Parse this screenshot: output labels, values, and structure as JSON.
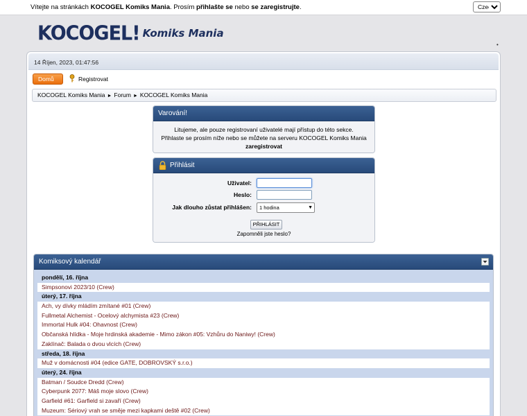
{
  "topbar": {
    "welcome_prefix": "Vítejte na stránkách ",
    "site_name": "KOCOGEL Komiks Mania",
    "welcome_mid": ". Prosím ",
    "login_link": "přihlašte se",
    "welcome_or": " nebo ",
    "register_link": "se zaregistrujte",
    "welcome_end": ".",
    "language": "Czech"
  },
  "logo": {
    "main": "KOCOGEL!",
    "sub": "Komiks Mania"
  },
  "header": {
    "datetime": "14 Říjen, 2023, 01:47:56"
  },
  "menu": {
    "home": "Domů",
    "register": "Registrovat"
  },
  "breadcrumb": [
    "KOCOGEL Komiks Mania",
    "Forum",
    "KOCOGEL Komiks Mania"
  ],
  "warning": {
    "title": "Varování!",
    "line1": "Litujeme, ale pouze registrovaní uživatelé mají přístup do této sekce.",
    "line2": "Přihlaste se prosím níže nebo se můžete na serveru KOCOGEL Komiks Mania",
    "register_link": "zaregistrovat"
  },
  "login": {
    "title": "Přihlásit",
    "user_label": "Uživatel:",
    "pass_label": "Heslo:",
    "stay_label": "Jak dlouho zůstat přihlášen:",
    "stay_value": "1 hodina",
    "submit": "PŘIHLÁSIT",
    "forgot": "Zapomněli jste heslo?"
  },
  "calendar": {
    "title": "Komiksový kalendář",
    "rows": [
      {
        "type": "day",
        "text": "pondělí, 16. října"
      },
      {
        "type": "event",
        "text": "Simpsonovi 2023/10 (Crew)"
      },
      {
        "type": "day",
        "text": "úterý, 17. října"
      },
      {
        "type": "event",
        "text": "Ach, vy dívky mládím zmítané #01 (Crew)"
      },
      {
        "type": "event",
        "text": "Fullmetal Alchemist - Ocelový alchymista #23 (Crew)"
      },
      {
        "type": "event",
        "text": "Immortal Hulk #04: Ohavnost (Crew)"
      },
      {
        "type": "event",
        "text": "Občanská hlídka - Moje hrdinská akademie - Mimo zákon #05: Vzhůru do Naniwy! (Crew)"
      },
      {
        "type": "event",
        "text": "Zaklínač: Balada o dvou vlcích (Crew)"
      },
      {
        "type": "day",
        "text": "středa, 18. října"
      },
      {
        "type": "event",
        "text": "Muž v domácnosti #04 (edice GATE, DOBROVSKÝ s.r.o.)"
      },
      {
        "type": "day",
        "text": "úterý, 24. října"
      },
      {
        "type": "event",
        "text": "Batman / Soudce Dredd (Crew)"
      },
      {
        "type": "event",
        "text": "Cyberpunk 2077: Máš moje slovo (Crew)"
      },
      {
        "type": "event",
        "text": "Garfield #61: Garfield si zavaří (Crew)"
      },
      {
        "type": "event",
        "text": "Muzeum: Sériový vrah se směje mezi kapkami deště #02 (Crew)"
      }
    ]
  },
  "colors": {
    "header_blue": "#284a7a",
    "accent_orange": "#ea6f0d",
    "event_text": "#6b1616",
    "day_bg": "#c9d6ec"
  }
}
